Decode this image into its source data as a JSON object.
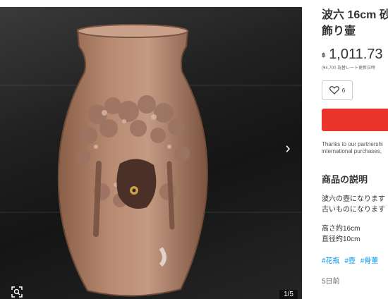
{
  "product": {
    "title_line1": "波六 16cm 砂",
    "title_line2": "飾り壷",
    "currency": "฿",
    "price": "1,011.73",
    "sub_price": "(¥4,700 為替レート更新日時",
    "likes": "6",
    "thanks_line1": "Thanks to our partnershi",
    "thanks_line2": "international purchases,"
  },
  "description": {
    "heading": "商品の説明",
    "line1": "波六の壺になります",
    "line2": "古いものになります",
    "line3": "高さ約16cm",
    "line4": "直径約10cm"
  },
  "tags": [
    "#花瓶",
    "#壺",
    "#骨董"
  ],
  "posted": "5日前",
  "gallery": {
    "counter": "1/5",
    "next_glyph": "›"
  },
  "colors": {
    "buy_button": "#ea352d",
    "tag_link": "#0095ee"
  }
}
